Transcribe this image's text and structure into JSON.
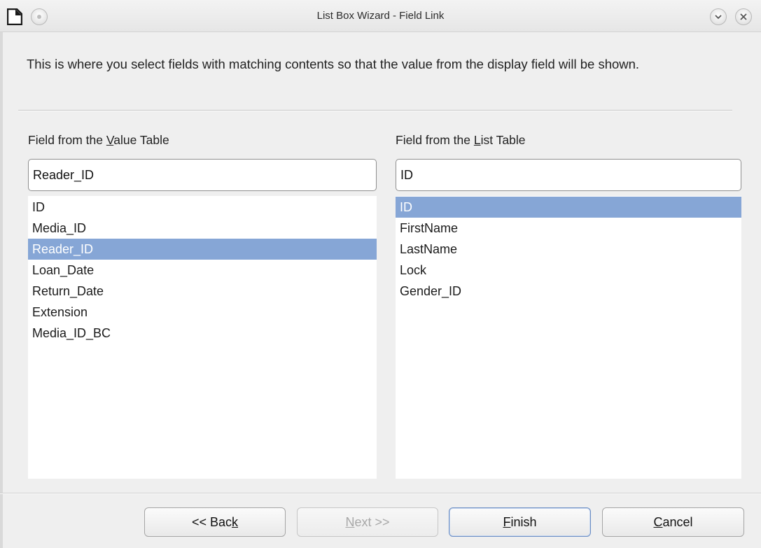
{
  "window": {
    "title": "List Box Wizard - Field Link"
  },
  "intro": {
    "text": "This is where you select fields with matching contents so that the value from the display field will be shown."
  },
  "value_table": {
    "label_prefix": "Field from the ",
    "label_mnemonic": "V",
    "label_suffix": "alue Table",
    "selected_value": "Reader_ID",
    "items": [
      "ID",
      "Media_ID",
      "Reader_ID",
      "Loan_Date",
      "Return_Date",
      "Extension",
      "Media_ID_BC"
    ],
    "selected_index": 2
  },
  "list_table": {
    "label_prefix": "Field from the ",
    "label_mnemonic": "L",
    "label_suffix": "ist Table",
    "selected_value": "ID",
    "items": [
      "ID",
      "FirstName",
      "LastName",
      "Lock",
      "Gender_ID"
    ],
    "selected_index": 0
  },
  "buttons": {
    "back": {
      "prefix": "<< Bac",
      "mnemonic": "k",
      "suffix": ""
    },
    "next": {
      "prefix": "",
      "mnemonic": "N",
      "suffix": "ext >>"
    },
    "finish": {
      "prefix": "",
      "mnemonic": "F",
      "suffix": "inish"
    },
    "cancel": {
      "prefix": "",
      "mnemonic": "C",
      "suffix": "ancel"
    }
  },
  "colors": {
    "selection": "#86a6d6",
    "window_bg": "#efefef"
  },
  "icons": {
    "app": "document-icon",
    "menu": "window-menu-icon",
    "minimize": "chevron-down-icon",
    "close": "close-icon"
  }
}
